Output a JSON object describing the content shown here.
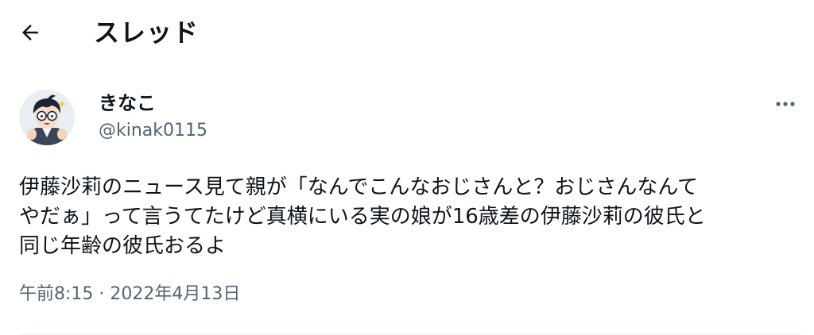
{
  "header": {
    "back_icon": "arrow-left-icon",
    "title": "スレッド"
  },
  "tweet": {
    "author": {
      "display_name": "きなこ",
      "handle": "@kinak0115",
      "avatar_icon": "cartoon-boy-with-glasses-avatar"
    },
    "more_icon": "ellipsis-icon",
    "text_lines": [
      "伊藤沙莉のニュース見て親が「なんでこんなおじさんと？おじさんなんて",
      "やだぁ」って言うてたけど真横にいる実の娘が16歳差の伊藤沙莉の彼氏と",
      "同じ年齢の彼氏おるよ"
    ],
    "timestamp": "午前8:15 · 2022年4月13日"
  },
  "colors": {
    "text_primary": "#0f1419",
    "text_secondary": "#536471",
    "divider": "#eff3f4"
  }
}
